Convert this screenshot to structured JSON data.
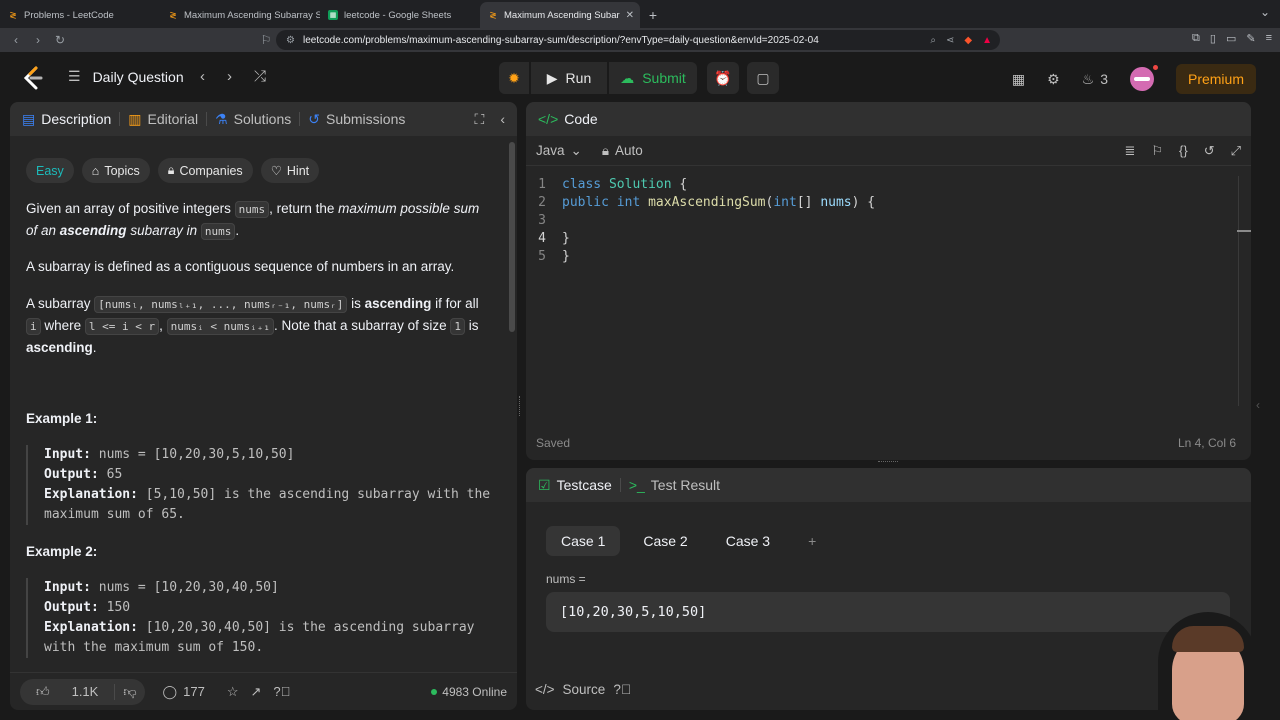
{
  "browser": {
    "tabs": [
      {
        "title": "Problems - LeetCode",
        "active": false
      },
      {
        "title": "Maximum Ascending Subarray S",
        "active": false
      },
      {
        "title": "leetcode - Google Sheets",
        "active": false
      },
      {
        "title": "Maximum Ascending Subar",
        "active": true
      }
    ],
    "url": "leetcode.com/problems/maximum-ascending-subarray-sum/description/?envType=daily-question&envId=2025-02-04"
  },
  "nav": {
    "title": "Daily Question",
    "run": "Run",
    "submit": "Submit",
    "streak": "3",
    "premium": "Premium"
  },
  "left": {
    "tabs": [
      "Description",
      "Editorial",
      "Solutions",
      "Submissions"
    ],
    "tags": {
      "difficulty": "Easy",
      "topics": "Topics",
      "companies": "Companies",
      "hint": "Hint"
    },
    "p1": {
      "a": "Given an array of positive integers ",
      "c1": "nums",
      "b": ", return the ",
      "i1": "maximum possible sum of an ",
      "bold": "ascending",
      "i2": " subarray in ",
      "c2": "nums",
      "end": "."
    },
    "p2": "A subarray is defined as a contiguous sequence of numbers in an array.",
    "p3": {
      "a": "A subarray ",
      "code": "[numsₗ, numsₗ₊₁, ..., numsᵣ₋₁, numsᵣ]",
      "b": " is ",
      "bold": "ascending",
      "c": " if for all ",
      "i": "i",
      "d": " where ",
      "cond": "l <= i < r",
      "e": ", ",
      "cond2": "numsᵢ  < numsᵢ₊₁",
      "f": ". Note that a subarray of size ",
      "one": "1",
      "g": " is ",
      "bold2": "ascending",
      "h": "."
    },
    "examples": [
      {
        "title": "Example 1:",
        "input": "nums = [10,20,30,5,10,50]",
        "output": "65",
        "explanation": "[5,10,50] is the ascending subarray with the maximum sum of 65."
      },
      {
        "title": "Example 2:",
        "input": "nums = [10,20,30,40,50]",
        "output": "150",
        "explanation": "[10,20,30,40,50] is the ascending subarray with the maximum sum of 150."
      }
    ],
    "labels": {
      "input": "Input:",
      "output": "Output:",
      "explanation": "Explanation:"
    },
    "footer": {
      "likes": "1.1K",
      "comments": "177",
      "online": "4983 Online"
    }
  },
  "code": {
    "header": "Code",
    "language": "Java",
    "mode": "Auto",
    "lines": [
      "1",
      "2",
      "3",
      "4",
      "5"
    ],
    "saved": "Saved",
    "position": "Ln 4, Col 6"
  },
  "testcase": {
    "tabs": [
      "Testcase",
      "Test Result"
    ],
    "cases": [
      "Case 1",
      "Case 2",
      "Case 3"
    ],
    "label": "nums =",
    "value": "[10,20,30,5,10,50]",
    "source": "Source"
  },
  "colors": {
    "accent": "#ffa116",
    "green": "#2cbb5d",
    "easy": "#1cbaba"
  }
}
